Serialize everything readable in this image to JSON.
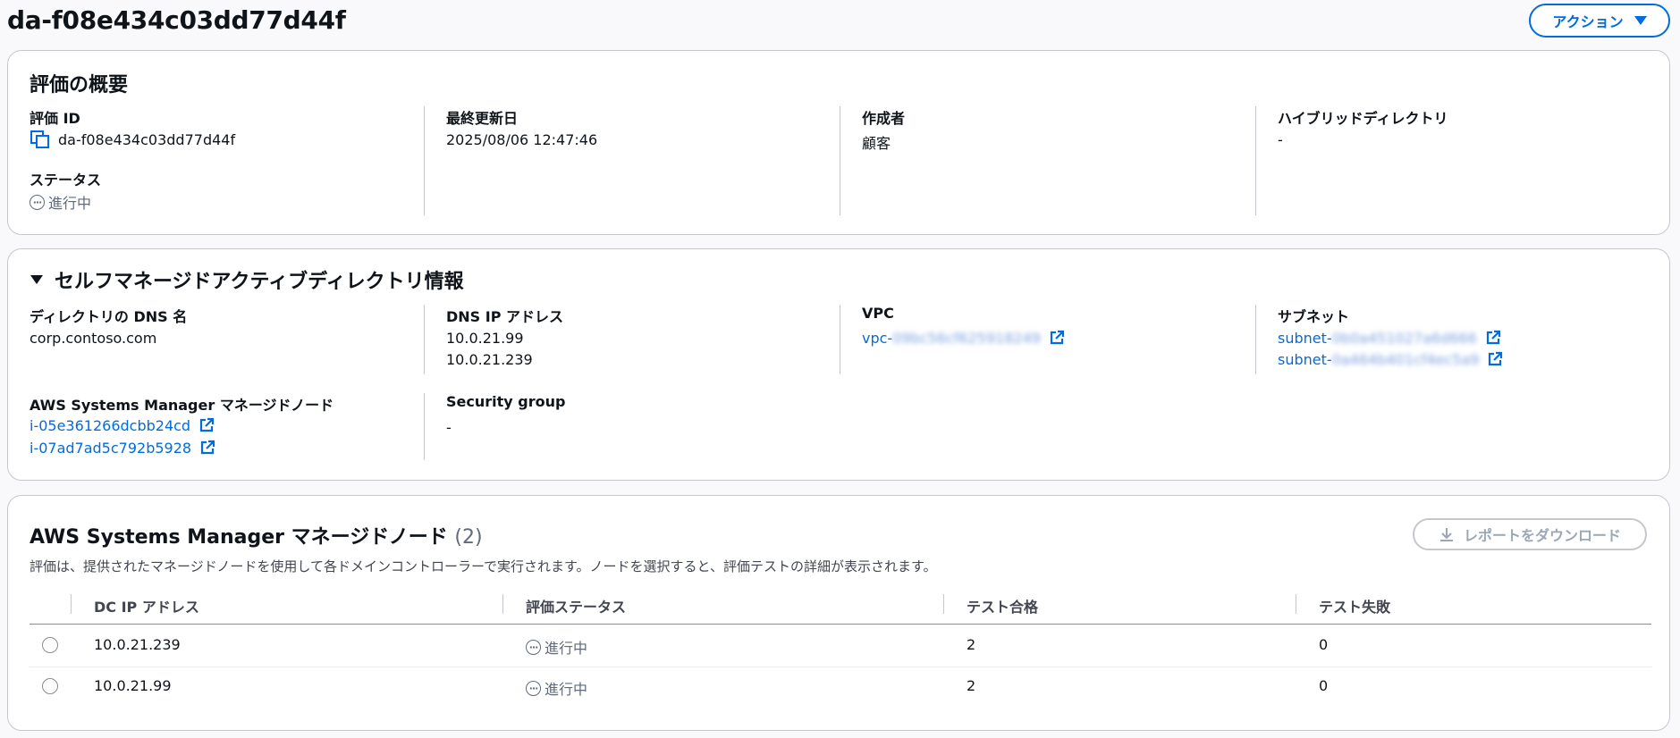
{
  "header": {
    "title": "da-f08e434c03dd77d44f",
    "action_label": "アクション"
  },
  "summary": {
    "title": "評価の概要",
    "assessment_id_label": "評価 ID",
    "assessment_id_value": "da-f08e434c03dd77d44f",
    "status_label": "ステータス",
    "status_value": "進行中",
    "last_updated_label": "最終更新日",
    "last_updated_value": "2025/08/06 12:47:46",
    "creator_label": "作成者",
    "creator_value": "顧客",
    "hybrid_label": "ハイブリッドディレクトリ",
    "hybrid_value": "-"
  },
  "directory": {
    "title": "セルフマネージドアクティブディレクトリ情報",
    "dns_name_label": "ディレクトリの DNS 名",
    "dns_name_value": "corp.contoso.com",
    "dns_ip_label": "DNS IP アドレス",
    "dns_ips": [
      "10.0.21.99",
      "10.0.21.239"
    ],
    "vpc_label": "VPC",
    "vpc_prefix": "vpc-",
    "vpc_hidden": "09bc56cf625918249",
    "subnet_label": "サブネット",
    "subnet_prefix": "subnet-",
    "subnets_hidden": [
      "0b0a451027a6d666",
      "0a464b401cf4ec5a9"
    ],
    "ssm_label": "AWS Systems Manager マネージドノード",
    "ssm_nodes": [
      "i-05e361266dcbb24cd",
      "i-07ad7ad5c792b5928"
    ],
    "sg_label": "Security group",
    "sg_value": "-"
  },
  "nodes": {
    "title": "AWS Systems Manager マネージドノード",
    "count": "(2)",
    "description": "評価は、提供されたマネージドノードを使用して各ドメインコントローラーで実行されます。ノードを選択すると、評価テストの詳細が表示されます。",
    "download_label": "レポートをダウンロード",
    "columns": [
      "DC IP アドレス",
      "評価ステータス",
      "テスト合格",
      "テスト失敗"
    ],
    "rows": [
      {
        "ip": "10.0.21.239",
        "status": "進行中",
        "passed": "2",
        "failed": "0"
      },
      {
        "ip": "10.0.21.99",
        "status": "進行中",
        "passed": "2",
        "failed": "0"
      }
    ]
  }
}
